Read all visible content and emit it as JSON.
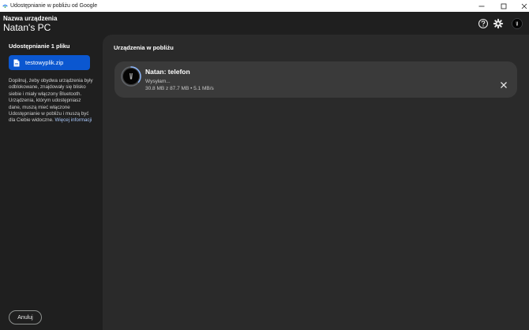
{
  "window": {
    "title": "Udostępnianie w pobliżu od Google",
    "icons": {
      "app": "nearby-share-icon",
      "minimize": "minimize-icon",
      "maximize": "maximize-icon",
      "close": "close-icon"
    }
  },
  "header": {
    "device_label": "Nazwa urządzenia",
    "device_name": "Natan's PC",
    "icons": {
      "help": "help-icon",
      "settings": "gear-icon",
      "profile": "avatar"
    }
  },
  "sidebar": {
    "share_title": "Udostępnianie 1 pliku",
    "file_name": "testowyplik.zip",
    "description": "Dopilnuj, żeby obydwa urządzenia były odblokowane, znajdowały się blisko siebie i miały włączony Bluetooth. Urządzenia, którym udostępniasz dane, muszą mieć włączone Udostępnianie w pobliżu i muszą być dla Ciebie widoczne.",
    "learn_more": "Więcej informacji",
    "cancel_label": "Anuluj"
  },
  "main": {
    "section_title": "Urządzenia w pobliżu",
    "device": {
      "name": "Natan: telefon",
      "status": "Wysyłam...",
      "progress": "30.8 MB z 87.7 MB • 5.1 MB/s",
      "progress_fraction": 0.351
    }
  },
  "colors": {
    "accent": "#0b57d0",
    "link": "#a8c7fa",
    "background": "#1f1f1f",
    "panel": "#2a2a2a",
    "card": "#3a3a3a",
    "progress": "#8ab4f8"
  }
}
